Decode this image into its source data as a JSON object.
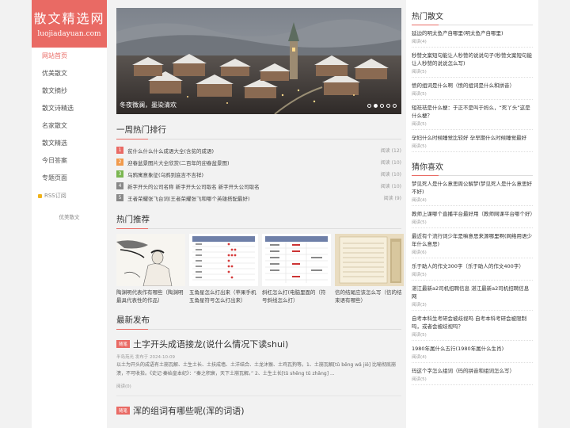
{
  "site": {
    "name": "散文精选网",
    "domain": "luojiadayuan.com"
  },
  "nav": [
    {
      "label": "网站首页",
      "active": true
    },
    {
      "label": "优美散文"
    },
    {
      "label": "散文摘抄"
    },
    {
      "label": "散文诗精选"
    },
    {
      "label": "名家散文"
    },
    {
      "label": "散文精选"
    },
    {
      "label": "今日答案"
    },
    {
      "label": "专题页面"
    }
  ],
  "rss_label": "RSS订阅",
  "side_footer": "优美散文",
  "slider": {
    "caption": "冬夜微澜，墨染清欢",
    "dot_count": 5,
    "active_dot": 1
  },
  "weekly": {
    "title": "一周热门排行",
    "items": [
      {
        "num": "1",
        "color": "#e96a64",
        "title": "贫什么什么什么成语大全(含贫的成语)",
        "reads": "阅读 (12)"
      },
      {
        "num": "2",
        "color": "#f19a4c",
        "title": "迎春盆景图片大全欣赏(二百年的迎春盆景图)",
        "reads": "阅读 (10)"
      },
      {
        "num": "3",
        "color": "#7ab650",
        "title": "乌鸦寓意象征(乌鸦到底吉不吉祥)",
        "reads": "阅读 (10)"
      },
      {
        "num": "4",
        "color": "#888888",
        "title": "新字开头的公司名称 新字开头公司取名 新字开头公司取名",
        "reads": "阅读 (10)"
      },
      {
        "num": "5",
        "color": "#888888",
        "title": "王者荣耀张飞台词(王者荣耀张飞和哪个英雄搭配最好)",
        "reads": "阅读 (9)"
      }
    ]
  },
  "hot": {
    "title": "热门推荐",
    "cards": [
      {
        "title": "陶渊明代表作有哪些（陶渊明最具代表性的作品）"
      },
      {
        "title": "五角星怎么打出来（苹果手机五角星符号怎么打出来）"
      },
      {
        "title": "斜杠怎么打(电脑里面的（符号斜线怎么打）"
      },
      {
        "title": "信的结尾应该怎么写（信的结束语有哪些）"
      }
    ]
  },
  "latest": {
    "title": "最新发布",
    "posts": [
      {
        "tag": "随笔",
        "title": "土字开头成语接龙(说什么情况下读shui)",
        "meta": "半岛苑光 发布于 2024-10-09",
        "excerpt": "以土为开头的成语有土崩瓦解、土生土长、土扶成墙、土洋结合、土龙沐猴、土鸡瓦狗等。1、土崩瓦解[tǔ bēng wǎ jiě] 比喻彻底崩溃，不可收拾。《史记·秦始皇本纪》：“秦之积衰，天下土崩瓦解。” 2、土生土长[tǔ shēng tǔ zhǎng] ...",
        "reads": "阅读(0)"
      },
      {
        "tag": "随笔",
        "title": "浑的组词有哪些呢(浑的词语)"
      }
    ]
  },
  "hot_articles": {
    "title": "热门散文",
    "items": [
      {
        "text": "延边的明太鱼产自哪里(明太鱼产自哪里)",
        "reads": "阅读(4)"
      },
      {
        "text": "秒赞文案短句能让人秒赞的说说句子(秒赞文案短句能让人秒赞的说说怎么写)",
        "reads": "阅读(5)"
      },
      {
        "text": "愤的组词是什么啊（愤的组词是什么和拼音）",
        "reads": "阅读(5)"
      },
      {
        "text": "短祛祛是什么梗：于正不是叫于妈么，“死丫头”这是什么梗？",
        "reads": "阅读(5)"
      },
      {
        "text": "孕妇什么时候睡觉比较好 孕早期什么时候睡觉最好",
        "reads": "阅读(5)"
      }
    ]
  },
  "guess": {
    "title": "猜你喜欢",
    "items": [
      {
        "text": "梦见死人是什么意思周公解梦(梦见死人是什么意思好不好)",
        "reads": "阅读(4)"
      },
      {
        "text": "教师上课哪个直播平台最好用（教师网课平台哪个好）",
        "reads": "阅读(5)"
      },
      {
        "text": "最近有个流行词少年是嘛意思来源哪里啊(网络用语少年什么意思)",
        "reads": "阅读(6)"
      },
      {
        "text": "乐于助人的作文300字（乐于助人的作文400字）",
        "reads": "阅读(5)"
      },
      {
        "text": "湛江最新a2司机招聘信息 湛江最新a2司机招聘信息网",
        "reads": "阅读(3)"
      },
      {
        "text": "自考本科生考研会被歧视吗 自考本科考研会被限制吗，或者会被歧视吗？",
        "reads": "阅读(5)"
      },
      {
        "text": "1980年属什么五行(1980年属什么生肖)",
        "reads": "阅读(4)"
      },
      {
        "text": "玛这个字怎么组词（玛的拼音和组词怎么写）",
        "reads": "阅读(5)"
      }
    ]
  }
}
